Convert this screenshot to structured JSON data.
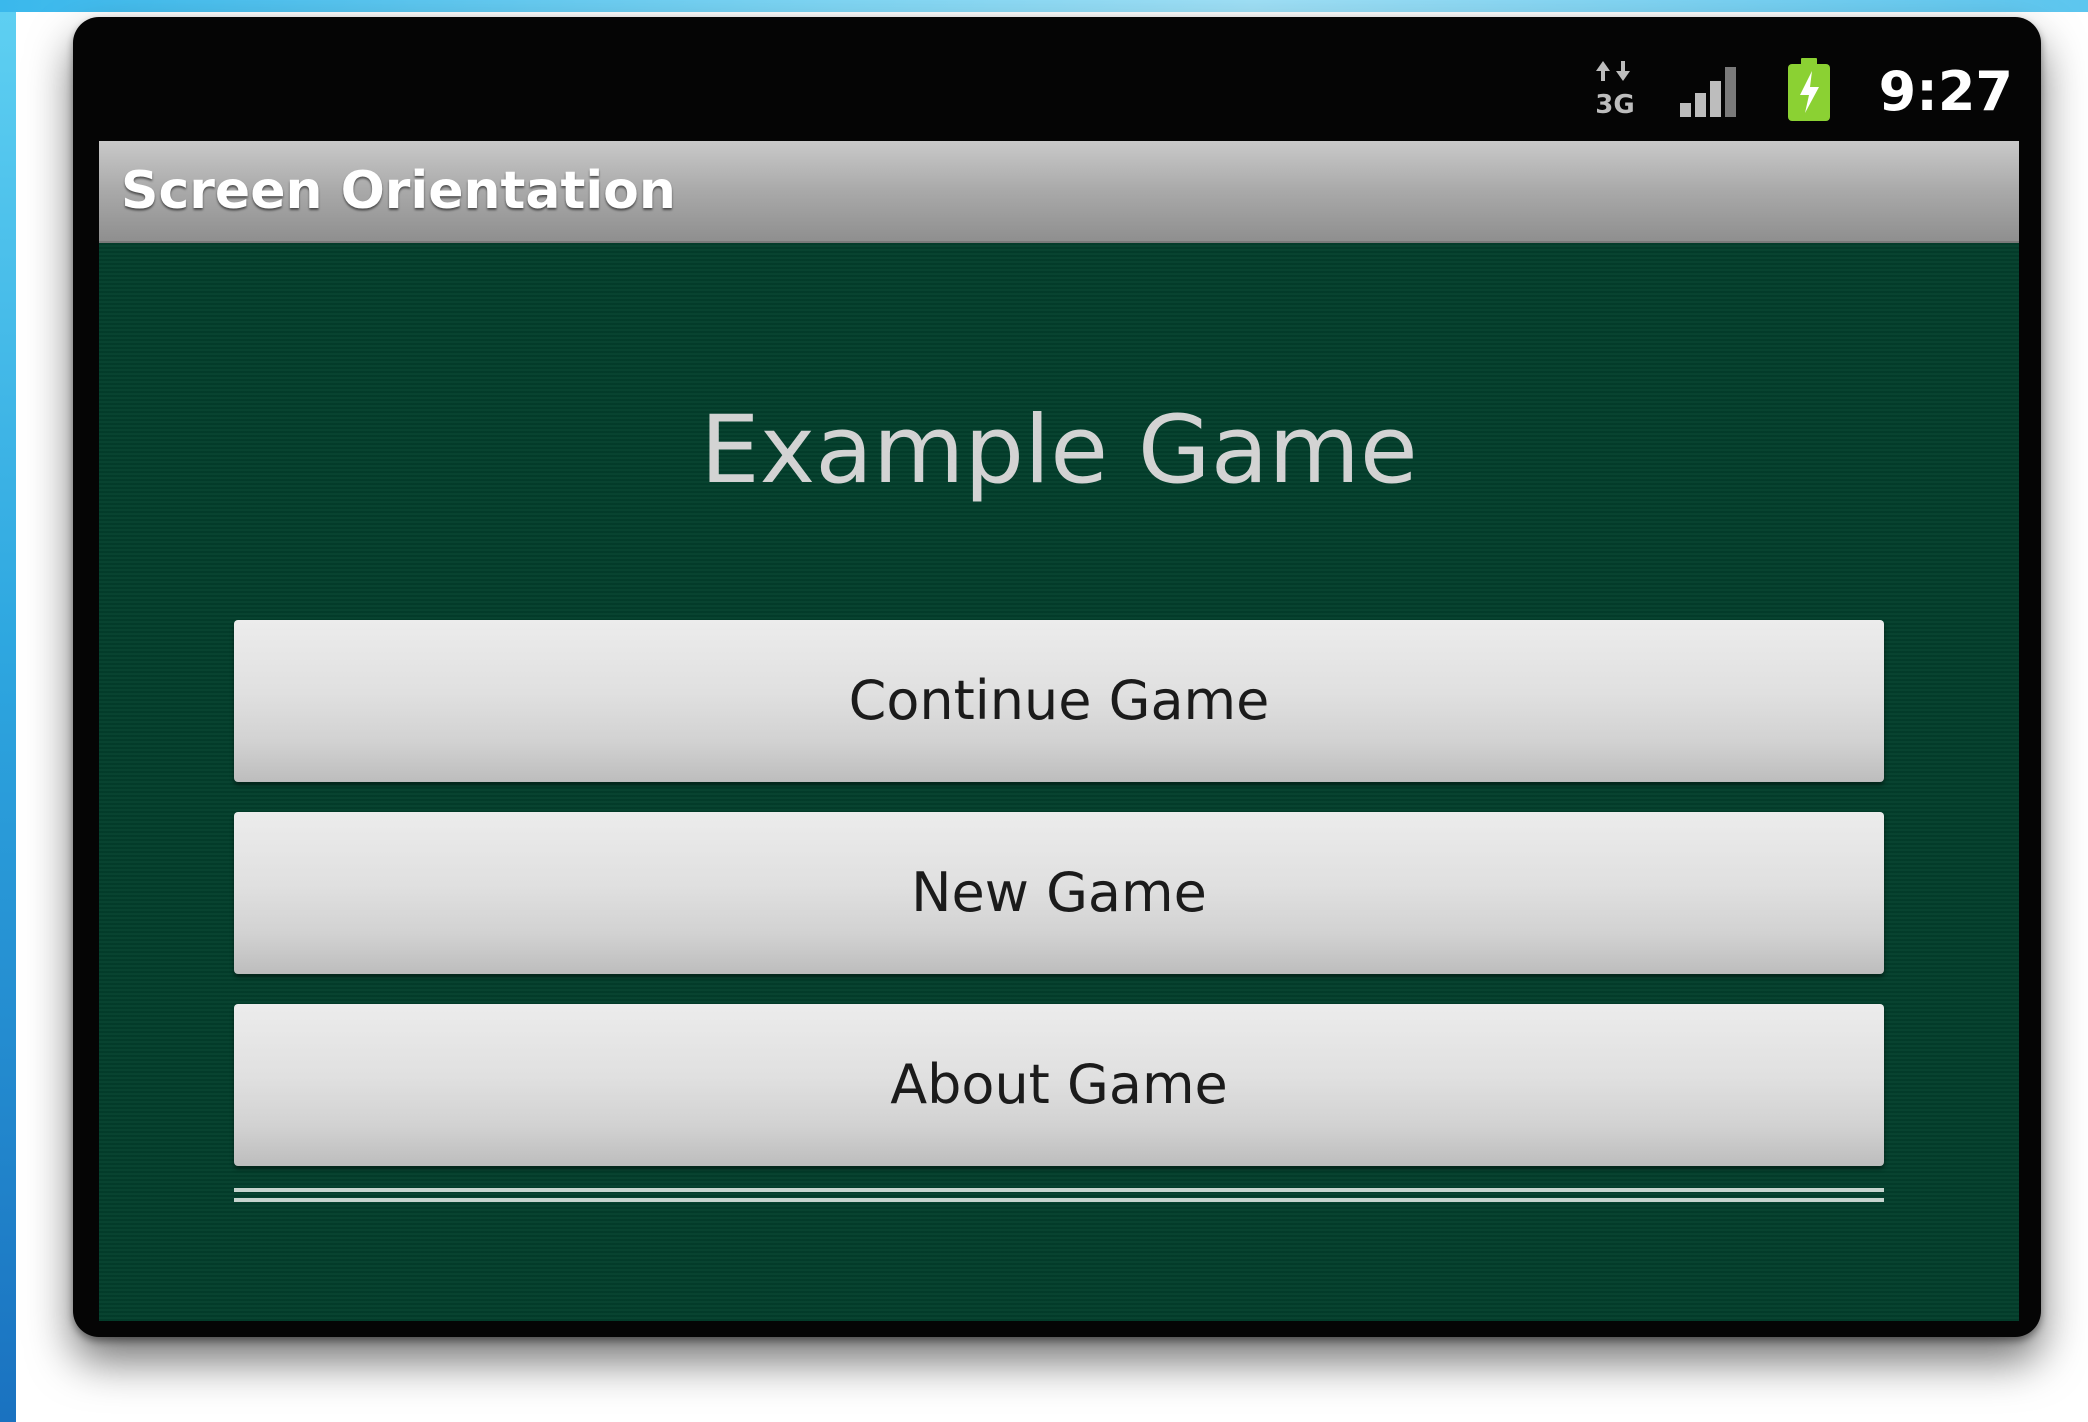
{
  "status_bar": {
    "time": "9:27",
    "network_icon": "3g-data-icon",
    "signal_icon": "signal-strength-icon",
    "battery_icon": "battery-charging-icon",
    "battery_color": "#8bd133"
  },
  "app": {
    "title": "Screen Orientation"
  },
  "main": {
    "heading": "Example Game",
    "buttons": [
      {
        "label": "Continue Game"
      },
      {
        "label": "New Game"
      },
      {
        "label": "About Game"
      }
    ]
  },
  "colors": {
    "screen_background": "#033f2c",
    "title_bar": "#a9a9a9",
    "heading_text": "#d3d3d3",
    "button": "#e0e0e0"
  }
}
